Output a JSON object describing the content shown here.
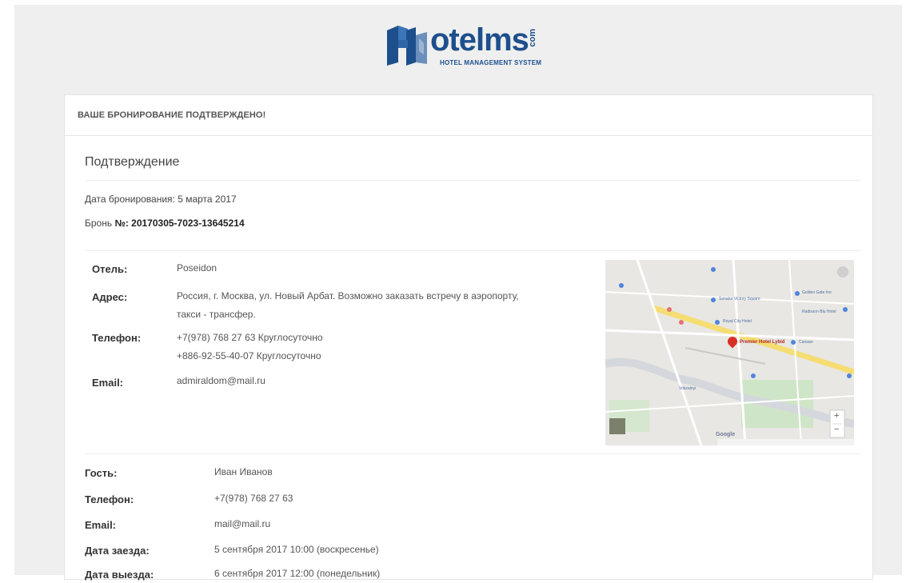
{
  "logo": {
    "word": "otelms",
    "com": "com",
    "subtitle": "HOTEL MANAGEMENT SYSTEM",
    "brand_color": "#1d4f8c"
  },
  "header": {
    "title": "ВАШЕ БРОНИРОВАНИЕ ПОДТВЕРЖДЕНО!"
  },
  "confirmation": {
    "section_title": "Подтверждение",
    "booking_date": "Дата бронирования: 5 марта 2017",
    "booking_number_label": "Бронь ",
    "booking_number": "№: 20170305-7023-13645214"
  },
  "hotel": {
    "hotel_label": "Отель:",
    "hotel_value": "Poseidon",
    "address_label": "Адрес:",
    "address_line1": "Россия, г. Москва, ул. Новый Арбат. Возможно заказать встречу в аэропорту,",
    "address_line2": "такси - трансфер.",
    "phone_label": "Телефон:",
    "phone_1": "+7(978) 768 27 63 Круглосуточно",
    "phone_2": "+886-92-55-40-07 Круглосуточно",
    "email_label": "Email:",
    "email_value": "admiraldom@mail.ru"
  },
  "map": {
    "pin_label": "Premier Hotel Lybid",
    "google_label": "Google",
    "zoom_in": "+",
    "zoom_out": "−",
    "places": [
      "Golden Gate Inn",
      "Senator Victory Square",
      "Royal City Hotel",
      "Radisson Blu Hotel",
      "Canaan",
      "Vokzalnyi"
    ]
  },
  "guest": {
    "guest_label": "Гость:",
    "guest_value": "Иван Иванов",
    "phone_label": "Телефон:",
    "phone_value": "+7(978) 768 27 63",
    "email_label": "Email:",
    "email_value": "mail@mail.ru",
    "checkin_label": "Дата заезда:",
    "checkin_value": "5 сентября 2017 10:00 (воскресенье)",
    "checkout_label": "Дата выезда:",
    "checkout_value": "6 сентября 2017 12:00 (понедельник)"
  }
}
